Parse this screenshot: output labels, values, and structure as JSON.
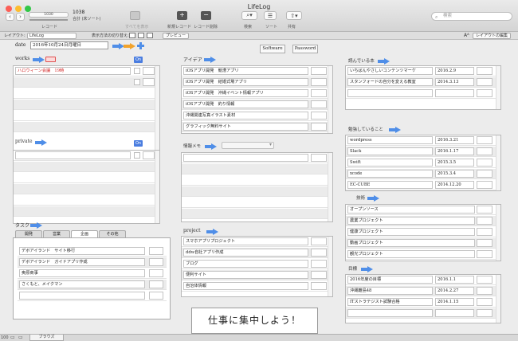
{
  "window": {
    "title": "LifeLog"
  },
  "toolbar": {
    "record_count": "1038",
    "record_total": "合計 (未ソート)",
    "record_label": "レコード",
    "record_input": "1030",
    "show_all": "すべてを表示",
    "new_record": "新規レコード",
    "delete_record": "レコード削除",
    "search": "検索",
    "sort": "ソート",
    "share": "共有",
    "search_placeholder": "検索"
  },
  "layoutbar": {
    "layout_label": "レイアウト:",
    "layout_value": "LifeLog",
    "view_label": "表示方法の切り替え:",
    "preview": "プレビュー",
    "edit_layout": "レイアウトの編集"
  },
  "date": {
    "label": "date",
    "value": "2016年10月24日月曜日"
  },
  "links": {
    "software": "Software",
    "password": "Password"
  },
  "works": {
    "label": "works",
    "on": "On",
    "rows": [
      "ハロウィーン会議　19時",
      "",
      "",
      "",
      "",
      ""
    ]
  },
  "private": {
    "label": "private",
    "on": "On",
    "rows": [
      "",
      "",
      "",
      "",
      "",
      ""
    ]
  },
  "tasks": {
    "label": "タスク",
    "tabs": [
      "開発",
      "営業",
      "企画",
      "その他"
    ],
    "active_tab": "企画",
    "rows": [
      "デボアイランド　サイト移行",
      "デボアイランド　ガイドアプリ作成",
      "奥原商事",
      "さくもと、メイクマン",
      "",
      ""
    ]
  },
  "ideas": {
    "label": "アイデア",
    "rows": [
      "iOSアプリ開発　競漕アプリ",
      "iOSアプリ開発　結婚式場アプリ",
      "iOSアプリ開発　沖縄イベント情報アプリ",
      "iOSアプリ開発　釣り情報",
      "沖縄関連写真イラスト素材",
      "グラフィック無料サイト"
    ]
  },
  "memo": {
    "label": "情報メモ",
    "rows": [
      "",
      "",
      "",
      "",
      ""
    ]
  },
  "project": {
    "label": "project",
    "rows": [
      "スマホアプリプロジェクト",
      "ddw自社アプリ作成",
      "ブログ",
      "便利サイト",
      "自治体情報"
    ]
  },
  "banner": "仕事に集中しよう！",
  "reading": {
    "label": "読んでいる本",
    "rows": [
      {
        "title": "いちばんやさしいコンテンツマーケ",
        "date": "2016.2.9"
      },
      {
        "title": "スタンフォードの自分を変える教室",
        "date": "2014.3.13"
      },
      {
        "title": "",
        "date": ""
      }
    ]
  },
  "studying": {
    "label": "勉強していること",
    "rows": [
      {
        "title": "wordpress",
        "date": "2016.3.21"
      },
      {
        "title": "Slack",
        "date": "2016.1.17"
      },
      {
        "title": "Swift",
        "date": "2015.3.5"
      },
      {
        "title": "xcode",
        "date": "2015.3.4"
      },
      {
        "title": "EC-CUBE",
        "date": "2014.12.20"
      }
    ]
  },
  "skills": {
    "label": "技術",
    "rows": [
      "オープンソース",
      "農業プロジェクト",
      "健康プロジェクト",
      "動画プロジェクト",
      "観光プロジェクト"
    ]
  },
  "goals": {
    "label": "目標",
    "rows": [
      {
        "title": "2016年度の目標",
        "date": "2016.1.1"
      },
      {
        "title": "沖縄離島48",
        "date": "2014.2.27"
      },
      {
        "title": "ITストラテジスト試験合格",
        "date": "2014.1.15"
      },
      {
        "title": "",
        "date": ""
      }
    ]
  },
  "status": {
    "zoom": "100",
    "mode": "ブラウズ"
  },
  "colors": {
    "accent_blue": "#4f8ee8",
    "arrow_orange": "#f2a32c",
    "alert_red": "#d02020"
  }
}
